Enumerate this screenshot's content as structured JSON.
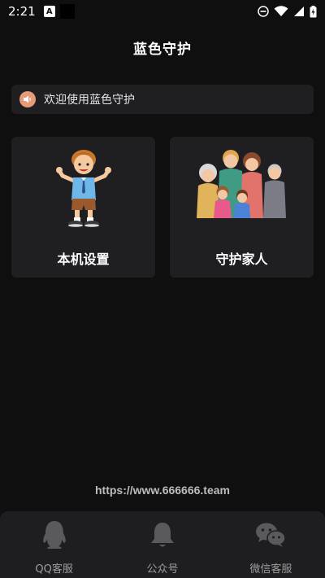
{
  "status_bar": {
    "time": "2:21",
    "notification_letter": "A",
    "icons": [
      "do-not-disturb-icon",
      "wifi-icon",
      "signal-icon",
      "battery-charging-icon"
    ]
  },
  "header": {
    "title": "蓝色守护"
  },
  "notice": {
    "icon": "speaker-icon",
    "text": "欢迎使用蓝色守护"
  },
  "cards": [
    {
      "label": "本机设置",
      "illustration": "boy-illustration"
    },
    {
      "label": "守护家人",
      "illustration": "family-illustration"
    }
  ],
  "footer": {
    "url": "https://www.666666.team"
  },
  "bottom_nav": {
    "items": [
      {
        "label": "QQ客服",
        "icon": "qq-penguin-icon"
      },
      {
        "label": "公众号",
        "icon": "bell-icon"
      },
      {
        "label": "微信客服",
        "icon": "wechat-icon"
      }
    ]
  },
  "colors": {
    "background": "#0f0f10",
    "card": "#1f1f22",
    "nav": "#1e1e20",
    "accent": "#e89b7a"
  }
}
